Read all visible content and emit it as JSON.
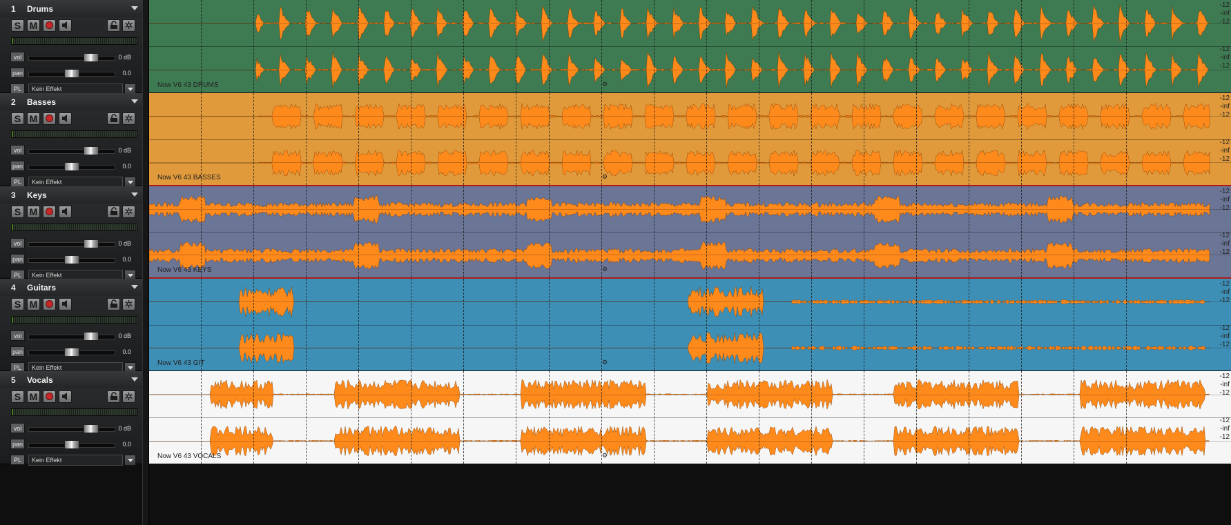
{
  "tracks": [
    {
      "num": "1",
      "name": "Drums",
      "clip": "Now V6 43 DRUMS",
      "vol": "vol",
      "vol_value": "0 dB",
      "pan": "pan",
      "pan_value": "0.0",
      "pl": "PL",
      "effect": "Kein Effekt",
      "color": "#3e7a52",
      "wave_color": "#ff8a1c"
    },
    {
      "num": "2",
      "name": "Basses",
      "clip": "Now V6 43 BASSES",
      "vol": "vol",
      "vol_value": "0 dB",
      "pan": "pan",
      "pan_value": "0.0",
      "pl": "PL",
      "effect": "Kein Effekt",
      "color": "#e09a3c",
      "wave_color": "#ff8a1c"
    },
    {
      "num": "3",
      "name": "Keys",
      "clip": "Now V6 43 KEYS",
      "vol": "vol",
      "vol_value": "0 dB",
      "pan": "pan",
      "pan_value": "0.0",
      "pl": "PL",
      "effect": "Kein Effekt",
      "color": "#6b7596",
      "wave_color": "#ff8a1c"
    },
    {
      "num": "4",
      "name": "Guitars",
      "clip": "Now V6 43 GIT",
      "vol": "vol",
      "vol_value": "0 dB",
      "pan": "pan",
      "pan_value": "0.0",
      "pl": "PL",
      "effect": "Kein Effekt",
      "color": "#3e8fb6",
      "wave_color": "#ff8a1c"
    },
    {
      "num": "5",
      "name": "Vocals",
      "clip": "Now V6 43 VOCALS",
      "vol": "vol",
      "vol_value": "0 dB",
      "pan": "pan",
      "pan_value": "0.0",
      "pl": "PL",
      "effect": "Kein Effekt",
      "color": "#f6f6f6",
      "wave_color": "#ff8a1c"
    }
  ],
  "buttons": {
    "solo": "S",
    "mute": "M"
  },
  "db_labels": {
    "top": "-12",
    "mid": "-inf",
    "bottom": "-12"
  },
  "icons": {
    "record": "record-icon",
    "monitor": "speaker-icon",
    "lock": "lock-icon",
    "freeze": "snowflake-icon",
    "menu": "chevron-down-icon",
    "cursor": "key-marker-icon"
  }
}
